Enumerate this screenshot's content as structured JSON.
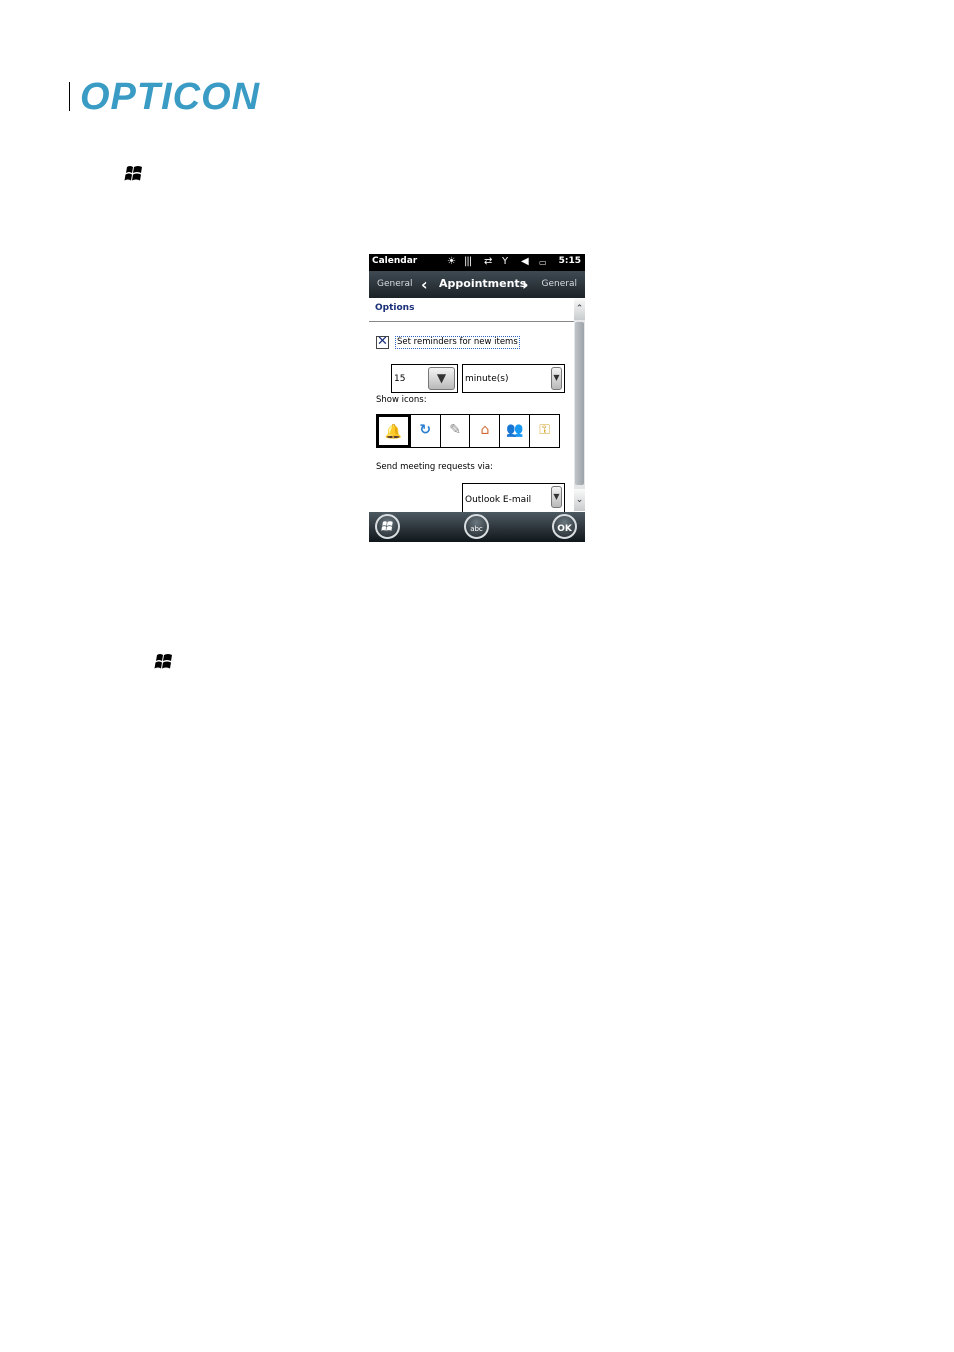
{
  "header": {
    "logo_text": "OPTICON",
    "logo_color": "#3a9cc4"
  },
  "page_icons": [
    "windows-flag-icon",
    "windows-flag-icon"
  ],
  "phone": {
    "status_bar": {
      "app_title": "Calendar",
      "time": "5:15",
      "icons": [
        "alarm-icon",
        "barcode-icon",
        "sync-arrows-icon",
        "signal-icon",
        "speaker-mute-icon",
        "battery-icon"
      ]
    },
    "nav": {
      "prev_label": "General",
      "current_label": "Appointments",
      "next_label": "General"
    },
    "section_title": "Options",
    "reminder": {
      "checked": true,
      "label": "Set reminders for new items"
    },
    "reminder_amount": {
      "value": "15"
    },
    "reminder_unit": {
      "value": "minute(s)"
    },
    "show_icons_label": "Show icons:",
    "icons": [
      "bell-icon",
      "recurrence-icon",
      "notes-icon",
      "location-home-icon",
      "attendees-icon",
      "private-key-icon"
    ],
    "send_label": "Send meeting requests via:",
    "send_via": {
      "value": "Outlook E-mail"
    },
    "softkeys": {
      "start": "windows-start-icon",
      "keyboard_label": "abc",
      "ok_label": "OK"
    }
  }
}
